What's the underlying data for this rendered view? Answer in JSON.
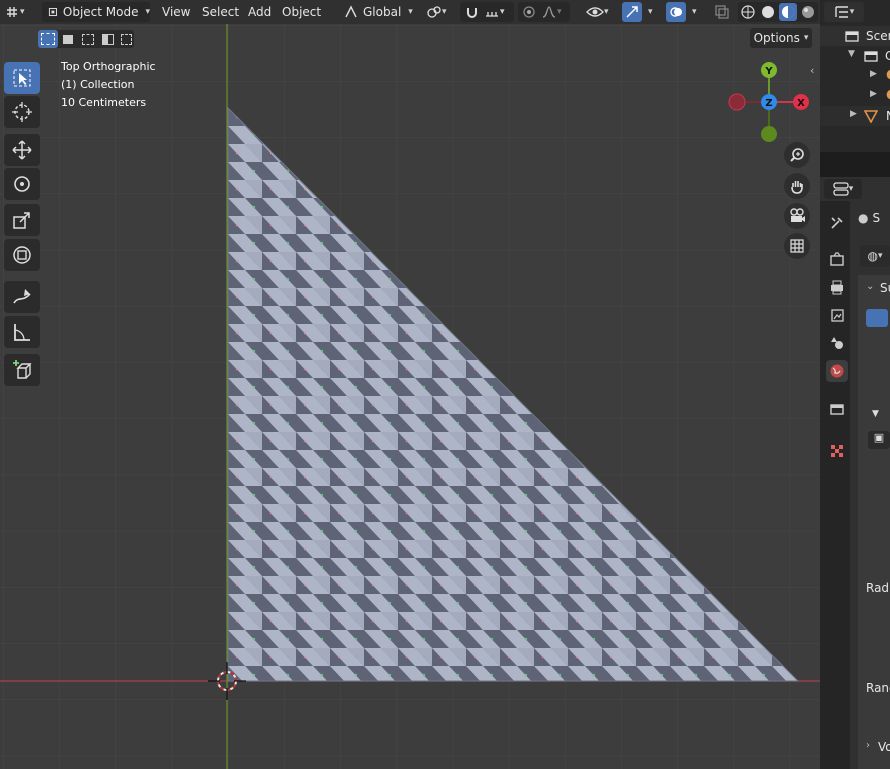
{
  "header": {
    "mode_label": "Object Mode",
    "menu": [
      "View",
      "Select",
      "Add",
      "Object"
    ],
    "transform_orientation": "Global"
  },
  "viewport": {
    "options_label": "Options",
    "overlay": {
      "view_name": "Top Orthographic",
      "collection": "(1) Collection",
      "scale": "10 Centimeters"
    },
    "gizmo": {
      "y": "Y",
      "z": "Z",
      "x": "X"
    },
    "colors": {
      "background": "#3d3d3d",
      "grid": "#484848",
      "x_axis": "#a8414b",
      "y_axis": "#6a8f2a",
      "active_tool": "#4772b3"
    }
  },
  "outliner": {
    "scene_label": "Scen",
    "row_label_1": "C",
    "row_label_last": "N"
  },
  "properties": {
    "panel_label": "S",
    "section_label": "Su",
    "radius_label": "Radi",
    "random_label": "Rand",
    "volume_label": "Vo"
  }
}
